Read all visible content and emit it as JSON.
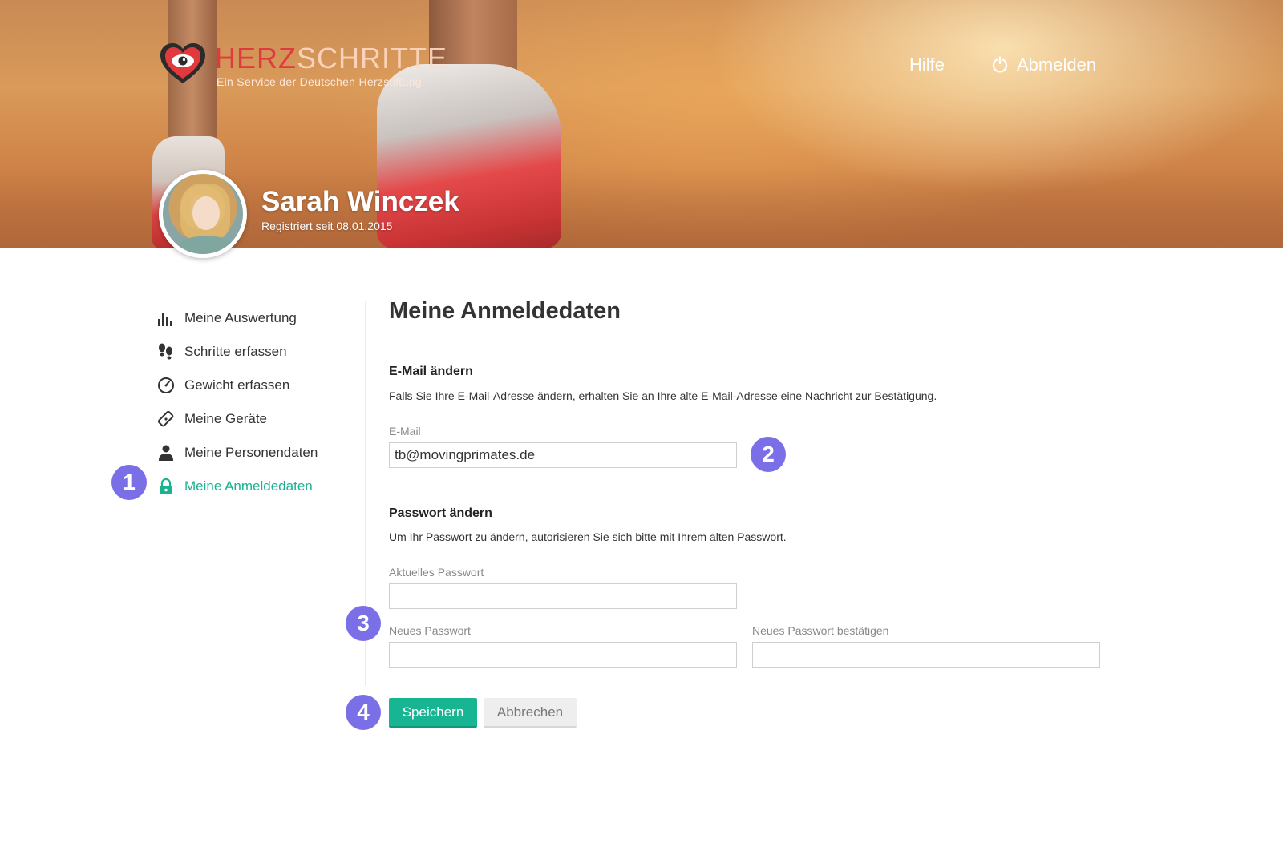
{
  "brand": {
    "name_part1": "HERZ",
    "name_part2": "SCHRITTE",
    "tagline": "Ein Service der Deutschen Herzstiftung"
  },
  "top_nav": {
    "help_label": "Hilfe",
    "logout_label": "Abmelden"
  },
  "profile": {
    "name": "Sarah Winczek",
    "registered": "Registriert seit 08.01.2015"
  },
  "sidebar": {
    "items": [
      {
        "label": "Meine Auswertung",
        "icon": "bar-chart-icon"
      },
      {
        "label": "Schritte erfassen",
        "icon": "footprints-icon"
      },
      {
        "label": "Gewicht erfassen",
        "icon": "scale-gauge-icon"
      },
      {
        "label": "Meine Geräte",
        "icon": "device-tag-icon"
      },
      {
        "label": "Meine Personendaten",
        "icon": "person-icon"
      },
      {
        "label": "Meine Anmeldedaten",
        "icon": "lock-icon",
        "active": true
      }
    ]
  },
  "main": {
    "title": "Meine Anmeldedaten",
    "email_section": {
      "title": "E-Mail ändern",
      "description": "Falls Sie Ihre E-Mail-Adresse ändern, erhalten Sie an Ihre alte E-Mail-Adresse eine Nachricht zur Bestätigung.",
      "email_label": "E-Mail",
      "email_value": "tb@movingprimates.de"
    },
    "password_section": {
      "title": "Passwort ändern",
      "description": "Um Ihr Passwort zu ändern, autorisieren Sie sich bitte mit Ihrem alten Passwort.",
      "current_label": "Aktuelles Passwort",
      "new_label": "Neues Passwort",
      "confirm_label": "Neues Passwort bestätigen"
    },
    "save_label": "Speichern",
    "cancel_label": "Abbrechen"
  },
  "markers": [
    "1",
    "2",
    "3",
    "4"
  ],
  "colors": {
    "accent": "#1bb28f",
    "brand_red": "#e03a3e",
    "marker": "#7b6fe8"
  }
}
